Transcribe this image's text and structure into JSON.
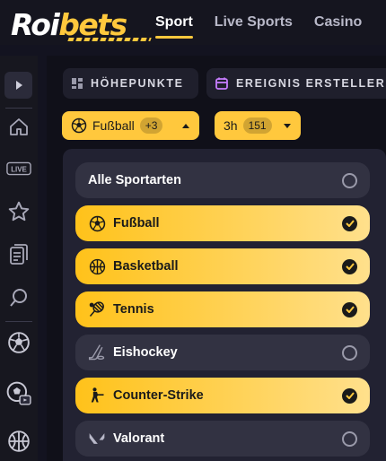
{
  "header": {
    "logo_roi": "Roi",
    "logo_bets": "bets",
    "tabs": [
      {
        "label": "Sport",
        "active": true
      },
      {
        "label": "Live Sports",
        "active": false
      },
      {
        "label": "Casino",
        "active": false
      }
    ]
  },
  "sidebar": {
    "icons": [
      "play-triangle-icon",
      "home-icon",
      "live-badge-icon",
      "star-icon",
      "betslip-icon",
      "search-icon",
      "soccer-ball-icon",
      "soccer-ball-tv-icon",
      "basketball-icon"
    ],
    "live_label": "LIVE"
  },
  "toolbar": {
    "highlights_label": "HÖHEPUNKTE",
    "event_builder_label": "EREIGNIS ERSTELLER"
  },
  "filters": {
    "sport": {
      "label": "Fußball",
      "count": "+3"
    },
    "time": {
      "label": "3h",
      "count": "151"
    }
  },
  "sports_dropdown": {
    "options": [
      {
        "label": "Alle Sportarten",
        "selected": false,
        "icon": ""
      },
      {
        "label": "Fußball",
        "selected": true,
        "icon": "soccer-ball-icon"
      },
      {
        "label": "Basketball",
        "selected": true,
        "icon": "basketball-icon"
      },
      {
        "label": "Tennis",
        "selected": true,
        "icon": "tennis-icon"
      },
      {
        "label": "Eishockey",
        "selected": false,
        "icon": "hockey-stick-icon"
      },
      {
        "label": "Counter-Strike",
        "selected": true,
        "icon": "counter-strike-icon"
      },
      {
        "label": "Valorant",
        "selected": false,
        "icon": "valorant-icon"
      }
    ]
  },
  "colors": {
    "accent": "#ffc83d",
    "background": "#131320",
    "panel": "#222232",
    "option_off": "#323242"
  }
}
